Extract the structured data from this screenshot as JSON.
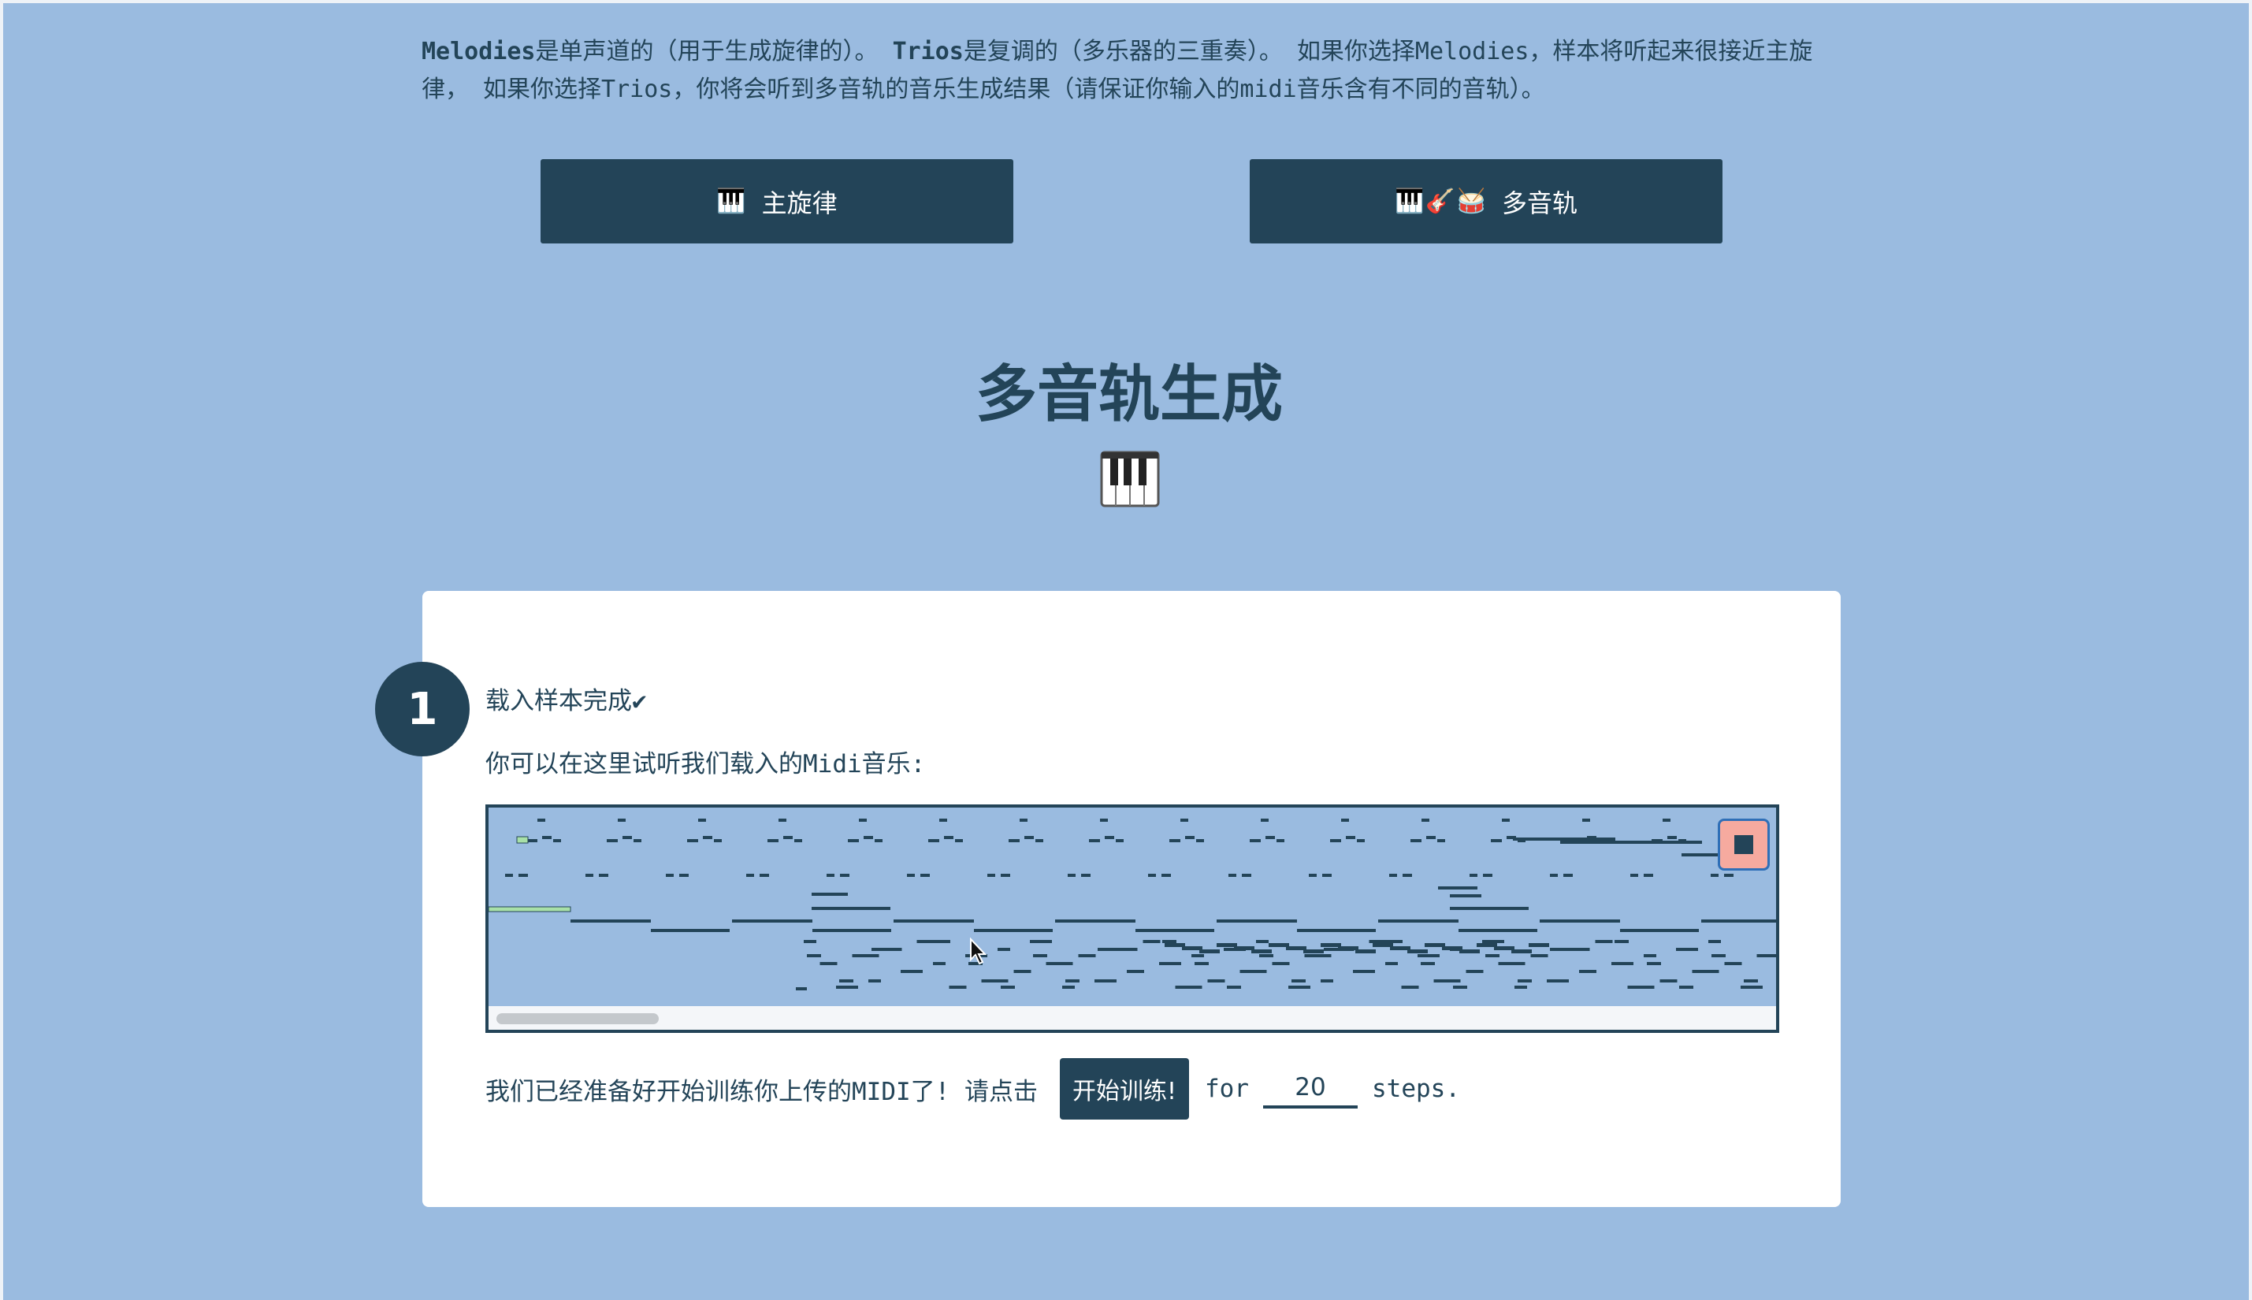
{
  "intro": {
    "melodies_word": "Melodies",
    "melodies_desc": "是单声道的（用于生成旋律的）。",
    "trios_word": "Trios",
    "trios_desc": "是复调的（多乐器的三重奏）。",
    "line_rest": "如果你选择Melodies，样本将听起来很接近主旋律， 如果你选择Trios，你将会听到多音轨的音乐生成结果（请保证你输入的midi音乐含有不同的音轨）。"
  },
  "modes": {
    "melody": {
      "icon": "🎹",
      "label": "主旋律"
    },
    "trio": {
      "icon": "🎹🎸🥁",
      "label": "多音轨"
    }
  },
  "page_title": "多音轨生成",
  "piano_icon": "piano-keys-icon",
  "step": {
    "number": "1",
    "status": "载入样本完成✔",
    "listen": "你可以在这里试听我们载入的Midi音乐:"
  },
  "player": {
    "state": "playing",
    "stop_icon": "stop-icon",
    "note_color": "#234458",
    "active_note_color": "#a8e0a8",
    "scroll_position": 0.0
  },
  "train": {
    "prefix": "我们已经准备好开始训练你上传的MIDI了! 请点击",
    "button": "开始训练!",
    "for": "for",
    "steps_value": "20",
    "suffix": "steps."
  }
}
